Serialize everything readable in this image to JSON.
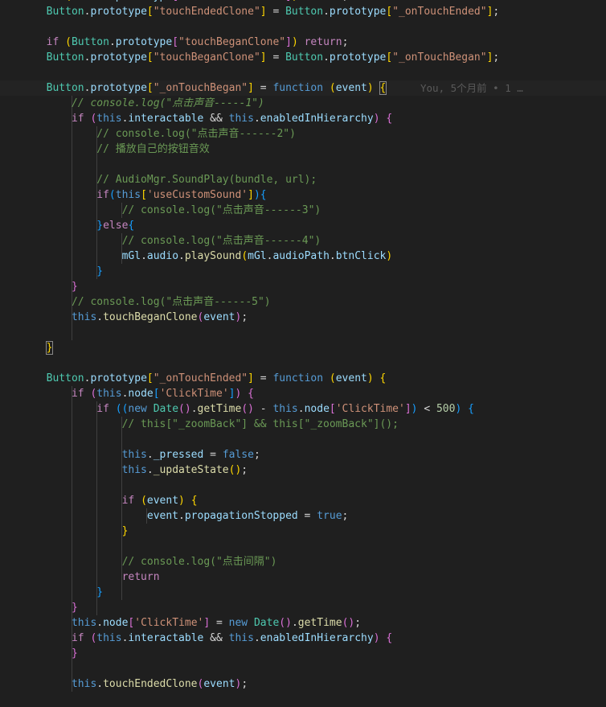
{
  "editor": {
    "lines": [
      {
        "current": false,
        "tokens": [
          [
            "  if ",
            "ck"
          ],
          [
            "(",
            "b1"
          ],
          [
            "Button",
            "cl"
          ],
          [
            ".",
            "p"
          ],
          [
            "prototype",
            "pr"
          ],
          [
            "[",
            "b2"
          ],
          [
            "\"touchEndedClone\"",
            "s"
          ],
          [
            "]",
            "b2"
          ],
          [
            ") ",
            "b1"
          ],
          [
            "return",
            "ck"
          ],
          [
            ";",
            "p"
          ]
        ]
      },
      {
        "current": false,
        "tokens": [
          [
            "  Button",
            "cl"
          ],
          [
            ".",
            "p"
          ],
          [
            "prototype",
            "pr"
          ],
          [
            "[",
            "b1"
          ],
          [
            "\"touchEndedClone\"",
            "s"
          ],
          [
            "]",
            "b1"
          ],
          [
            " = ",
            "p"
          ],
          [
            "Button",
            "cl"
          ],
          [
            ".",
            "p"
          ],
          [
            "prototype",
            "pr"
          ],
          [
            "[",
            "b1"
          ],
          [
            "\"_onTouchEnded\"",
            "s"
          ],
          [
            "]",
            "b1"
          ],
          [
            ";",
            "p"
          ]
        ]
      },
      {
        "current": false,
        "tokens": []
      },
      {
        "current": false,
        "tokens": [
          [
            "  if ",
            "ck"
          ],
          [
            "(",
            "b1"
          ],
          [
            "Button",
            "cl"
          ],
          [
            ".",
            "p"
          ],
          [
            "prototype",
            "pr"
          ],
          [
            "[",
            "b2"
          ],
          [
            "\"touchBeganClone\"",
            "s"
          ],
          [
            "]",
            "b2"
          ],
          [
            ") ",
            "b1"
          ],
          [
            "return",
            "ck"
          ],
          [
            ";",
            "p"
          ]
        ]
      },
      {
        "current": false,
        "tokens": [
          [
            "  Button",
            "cl"
          ],
          [
            ".",
            "p"
          ],
          [
            "prototype",
            "pr"
          ],
          [
            "[",
            "b1"
          ],
          [
            "\"touchBeganClone\"",
            "s"
          ],
          [
            "]",
            "b1"
          ],
          [
            " = ",
            "p"
          ],
          [
            "Button",
            "cl"
          ],
          [
            ".",
            "p"
          ],
          [
            "prototype",
            "pr"
          ],
          [
            "[",
            "b1"
          ],
          [
            "\"_onTouchBegan\"",
            "s"
          ],
          [
            "]",
            "b1"
          ],
          [
            ";",
            "p"
          ]
        ]
      },
      {
        "current": false,
        "tokens": []
      },
      {
        "current": true,
        "tokens": [
          [
            "  Button",
            "cl"
          ],
          [
            ".",
            "p"
          ],
          [
            "prototype",
            "pr"
          ],
          [
            "[",
            "b1"
          ],
          [
            "\"_onTouchBegan\"",
            "s"
          ],
          [
            "]",
            "b1"
          ],
          [
            " = ",
            "p"
          ],
          [
            "function ",
            "k"
          ],
          [
            "(",
            "b1"
          ],
          [
            "event",
            "pr"
          ],
          [
            ") ",
            "b1"
          ],
          [
            "{",
            "b1 bm"
          ]
        ],
        "blame": "You, 5个月前 • 1 …"
      },
      {
        "current": false,
        "tokens": [
          [
            "      // console.log(\"点击声音-----1\")",
            "ci"
          ]
        ]
      },
      {
        "current": false,
        "tokens": [
          [
            "      if ",
            "ck"
          ],
          [
            "(",
            "b2"
          ],
          [
            "this",
            "k"
          ],
          [
            ".",
            "p"
          ],
          [
            "interactable",
            "pr"
          ],
          [
            " && ",
            "p"
          ],
          [
            "this",
            "k"
          ],
          [
            ".",
            "p"
          ],
          [
            "enabledInHierarchy",
            "pr"
          ],
          [
            ") ",
            "b2"
          ],
          [
            "{",
            "b2"
          ]
        ]
      },
      {
        "current": false,
        "tokens": [
          [
            "          // console.log(\"点击声音------2\")",
            "c"
          ]
        ]
      },
      {
        "current": false,
        "tokens": [
          [
            "          // 播放自己的按钮音效",
            "c"
          ]
        ]
      },
      {
        "current": false,
        "tokens": []
      },
      {
        "current": false,
        "tokens": [
          [
            "          // AudioMgr.SoundPlay(bundle, url);",
            "c"
          ]
        ]
      },
      {
        "current": false,
        "tokens": [
          [
            "          if",
            "ck"
          ],
          [
            "(",
            "b3"
          ],
          [
            "this",
            "k"
          ],
          [
            "[",
            "b1"
          ],
          [
            "'useCustomSound'",
            "s"
          ],
          [
            "]",
            "b1"
          ],
          [
            ")",
            "b3"
          ],
          [
            "{",
            "b3"
          ]
        ]
      },
      {
        "current": false,
        "tokens": [
          [
            "              // console.log(\"点击声音------3\")",
            "c"
          ]
        ]
      },
      {
        "current": false,
        "tokens": [
          [
            "          }",
            "b3"
          ],
          [
            "else",
            "ck"
          ],
          [
            "{",
            "b3"
          ]
        ]
      },
      {
        "current": false,
        "tokens": [
          [
            "              // console.log(\"点击声音------4\")",
            "c"
          ]
        ]
      },
      {
        "current": false,
        "tokens": [
          [
            "              mGl",
            "pr"
          ],
          [
            ".",
            "p"
          ],
          [
            "audio",
            "pr"
          ],
          [
            ".",
            "p"
          ],
          [
            "playSound",
            "fn"
          ],
          [
            "(",
            "b1"
          ],
          [
            "mGl",
            "pr"
          ],
          [
            ".",
            "p"
          ],
          [
            "audioPath",
            "pr"
          ],
          [
            ".",
            "p"
          ],
          [
            "btnClick",
            "pr"
          ],
          [
            ")",
            "b1"
          ]
        ]
      },
      {
        "current": false,
        "tokens": [
          [
            "          }",
            "b3"
          ]
        ]
      },
      {
        "current": false,
        "tokens": [
          [
            "      }",
            "b2"
          ]
        ]
      },
      {
        "current": false,
        "tokens": [
          [
            "      // console.log(\"点击声音------5\")",
            "c"
          ]
        ]
      },
      {
        "current": false,
        "tokens": [
          [
            "      this",
            "k"
          ],
          [
            ".",
            "p"
          ],
          [
            "touchBeganClone",
            "fn"
          ],
          [
            "(",
            "b2"
          ],
          [
            "event",
            "pr"
          ],
          [
            ")",
            "b2"
          ],
          [
            ";",
            "p"
          ]
        ]
      },
      {
        "current": false,
        "tokens": []
      },
      {
        "current": false,
        "tokens": [
          [
            "  ",
            "p"
          ],
          [
            "}",
            "b1 bm"
          ]
        ]
      },
      {
        "current": false,
        "tokens": []
      },
      {
        "current": false,
        "tokens": [
          [
            "  Button",
            "cl"
          ],
          [
            ".",
            "p"
          ],
          [
            "prototype",
            "pr"
          ],
          [
            "[",
            "b1"
          ],
          [
            "\"_onTouchEnded\"",
            "s"
          ],
          [
            "]",
            "b1"
          ],
          [
            " = ",
            "p"
          ],
          [
            "function ",
            "k"
          ],
          [
            "(",
            "b1"
          ],
          [
            "event",
            "pr"
          ],
          [
            ") ",
            "b1"
          ],
          [
            "{",
            "b1"
          ]
        ]
      },
      {
        "current": false,
        "tokens": [
          [
            "      if ",
            "ck"
          ],
          [
            "(",
            "b2"
          ],
          [
            "this",
            "k"
          ],
          [
            ".",
            "p"
          ],
          [
            "node",
            "pr"
          ],
          [
            "[",
            "b3"
          ],
          [
            "'ClickTime'",
            "s"
          ],
          [
            "]",
            "b3"
          ],
          [
            ") ",
            "b2"
          ],
          [
            "{",
            "b2"
          ]
        ]
      },
      {
        "current": false,
        "tokens": [
          [
            "          if ",
            "ck"
          ],
          [
            "((",
            "b3"
          ],
          [
            "new ",
            "k"
          ],
          [
            "Date",
            "cl"
          ],
          [
            "()",
            "b2"
          ],
          [
            ".",
            "p"
          ],
          [
            "getTime",
            "fn"
          ],
          [
            "()",
            "b2"
          ],
          [
            " - ",
            "p"
          ],
          [
            "this",
            "k"
          ],
          [
            ".",
            "p"
          ],
          [
            "node",
            "pr"
          ],
          [
            "[",
            "b2"
          ],
          [
            "'ClickTime'",
            "s"
          ],
          [
            "]",
            "b2"
          ],
          [
            ") ",
            "b3"
          ],
          [
            "< ",
            "p"
          ],
          [
            "500",
            "n"
          ],
          [
            ") ",
            "b3"
          ],
          [
            "{",
            "b3"
          ]
        ]
      },
      {
        "current": false,
        "tokens": [
          [
            "              // this[\"_zoomBack\"] && this[\"_zoomBack\"]();",
            "c"
          ]
        ]
      },
      {
        "current": false,
        "tokens": []
      },
      {
        "current": false,
        "tokens": [
          [
            "              this",
            "k"
          ],
          [
            ".",
            "p"
          ],
          [
            "_pressed",
            "pr"
          ],
          [
            " = ",
            "p"
          ],
          [
            "false",
            "k"
          ],
          [
            ";",
            "p"
          ]
        ]
      },
      {
        "current": false,
        "tokens": [
          [
            "              this",
            "k"
          ],
          [
            ".",
            "p"
          ],
          [
            "_updateState",
            "fn"
          ],
          [
            "()",
            "b1"
          ],
          [
            ";",
            "p"
          ]
        ]
      },
      {
        "current": false,
        "tokens": []
      },
      {
        "current": false,
        "tokens": [
          [
            "              if ",
            "ck"
          ],
          [
            "(",
            "b1"
          ],
          [
            "event",
            "pr"
          ],
          [
            ") ",
            "b1"
          ],
          [
            "{",
            "b1"
          ]
        ]
      },
      {
        "current": false,
        "tokens": [
          [
            "                  event",
            "pr"
          ],
          [
            ".",
            "p"
          ],
          [
            "propagationStopped",
            "pr"
          ],
          [
            " = ",
            "p"
          ],
          [
            "true",
            "k"
          ],
          [
            ";",
            "p"
          ]
        ]
      },
      {
        "current": false,
        "tokens": [
          [
            "              }",
            "b1"
          ]
        ]
      },
      {
        "current": false,
        "tokens": []
      },
      {
        "current": false,
        "tokens": [
          [
            "              // console.log(\"点击间隔\")",
            "c"
          ]
        ]
      },
      {
        "current": false,
        "tokens": [
          [
            "              return",
            "ck"
          ]
        ]
      },
      {
        "current": false,
        "tokens": [
          [
            "          }",
            "b3"
          ]
        ]
      },
      {
        "current": false,
        "tokens": [
          [
            "      }",
            "b2"
          ]
        ]
      },
      {
        "current": false,
        "tokens": [
          [
            "      this",
            "k"
          ],
          [
            ".",
            "p"
          ],
          [
            "node",
            "pr"
          ],
          [
            "[",
            "b2"
          ],
          [
            "'ClickTime'",
            "s"
          ],
          [
            "]",
            "b2"
          ],
          [
            " = ",
            "p"
          ],
          [
            "new ",
            "k"
          ],
          [
            "Date",
            "cl"
          ],
          [
            "()",
            "b2"
          ],
          [
            ".",
            "p"
          ],
          [
            "getTime",
            "fn"
          ],
          [
            "()",
            "b2"
          ],
          [
            ";",
            "p"
          ]
        ]
      },
      {
        "current": false,
        "tokens": [
          [
            "      if ",
            "ck"
          ],
          [
            "(",
            "b2"
          ],
          [
            "this",
            "k"
          ],
          [
            ".",
            "p"
          ],
          [
            "interactable",
            "pr"
          ],
          [
            " && ",
            "p"
          ],
          [
            "this",
            "k"
          ],
          [
            ".",
            "p"
          ],
          [
            "enabledInHierarchy",
            "pr"
          ],
          [
            ") ",
            "b2"
          ],
          [
            "{",
            "b2"
          ]
        ]
      },
      {
        "current": false,
        "tokens": [
          [
            "      }",
            "b2"
          ]
        ]
      },
      {
        "current": false,
        "tokens": []
      },
      {
        "current": false,
        "tokens": [
          [
            "      this",
            "k"
          ],
          [
            ".",
            "p"
          ],
          [
            "touchEndedClone",
            "fn"
          ],
          [
            "(",
            "b2"
          ],
          [
            "event",
            "pr"
          ],
          [
            ")",
            "b2"
          ],
          [
            ";",
            "p"
          ]
        ]
      }
    ]
  }
}
